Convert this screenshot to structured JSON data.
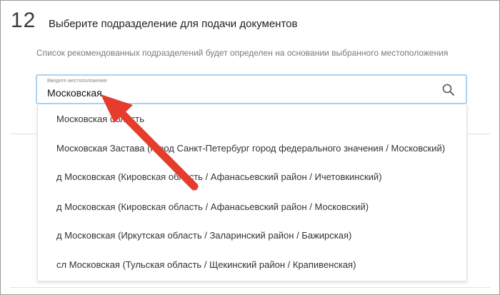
{
  "step": {
    "number": "12",
    "title": "Выберите подразделение для подачи документов",
    "hint": "Список рекомендованных подразделений будет определен на основании выбранного местоположения"
  },
  "location": {
    "label": "Введите местоположение",
    "value": "Московская",
    "search_icon": "search-icon"
  },
  "suggestions": [
    "Московская область",
    "Московская Застава (город Санкт-Петербург город федерального значения / Московский)",
    "д Московская (Кировская область / Афанасьевский район / Ичетовкинский)",
    "д Московская (Кировская область / Афанасьевский район / Московский)",
    "д Московская (Иркутская область / Заларинский район / Бажирская)",
    "сл Московская (Тульская область / Щекинский район / Крапивенская)"
  ],
  "colors": {
    "field_border": "#a9d4f2",
    "annotation_arrow": "#e53c2e"
  }
}
